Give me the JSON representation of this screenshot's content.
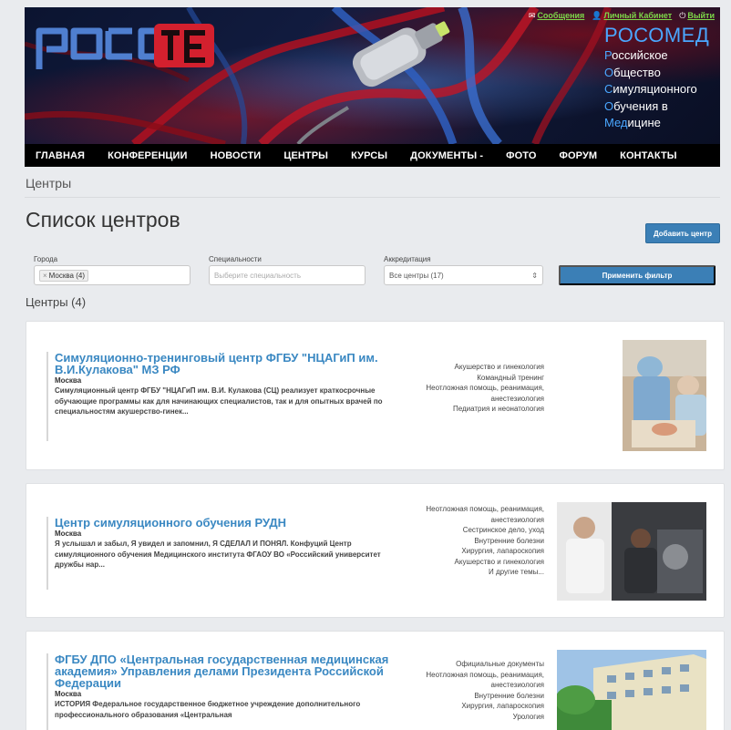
{
  "header": {
    "links": [
      {
        "icon": "envelope-icon",
        "glyph": "✉",
        "label": "Сообщения"
      },
      {
        "icon": "user-icon",
        "glyph": "👤",
        "label": "Личный Кабинет"
      },
      {
        "icon": "logout-icon",
        "glyph": "⏻",
        "label": "Выйти"
      }
    ],
    "brand_title": "РОСОМЕД",
    "brand_lines": [
      {
        "first": "Р",
        "rest": "оссийское"
      },
      {
        "first": "О",
        "rest": "бщество"
      },
      {
        "first": "С",
        "rest": "имуляционного"
      },
      {
        "first": "О",
        "rest": "бучения в"
      },
      {
        "first": "Мед",
        "rest": "ицине"
      }
    ]
  },
  "nav": [
    "ГЛАВНАЯ",
    "КОНФЕРЕНЦИИ",
    "НОВОСТИ",
    "ЦЕНТРЫ",
    "КУРСЫ",
    "ДОКУМЕНТЫ -",
    "ФОТО",
    "ФОРУМ",
    "КОНТАКТЫ"
  ],
  "breadcrumb": "Центры",
  "page_title": "Список центров",
  "add_button": "Добавить центр",
  "filters": {
    "city": {
      "label": "Города",
      "chip": "Москва (4)"
    },
    "specialty": {
      "label": "Специальности",
      "placeholder": "Выберите специальность"
    },
    "accreditation": {
      "label": "Аккредитация",
      "value": "Все центры (17)"
    },
    "apply": "Применить фильтр"
  },
  "section_title": "Центры (4)",
  "centers": [
    {
      "title": "Симуляционно-тренинговый центр ФГБУ \"НЦАГиП им. В.И.Кулакова\" МЗ РФ",
      "city": "Москва",
      "desc": "Симуляционный центр ФГБУ \"НЦАГиП им. В.И. Кулакова (СЦ) реализует краткосрочные обучающие программы как для начинающих специалистов, так и для опытных врачей по специальностям акушерство-гинек...",
      "tags": [
        "Акушерство и гинекология",
        "Командный тренинг",
        "Неотложная помощь, реанимация, анестезиология",
        "Педиатрия и неонатология"
      ]
    },
    {
      "title": "Центр симуляционного обучения РУДН",
      "city": "Москва",
      "desc": "Я услышал и забыл, Я увидел и запомнил, Я СДЕЛАЛ И ПОНЯЛ. Конфуций   Центр симуляционного обучения Медицинского института ФГАОУ ВО «Российский университет дружбы нар...",
      "tags": [
        "Неотложная помощь, реанимация, анестезиология",
        "Сестринское дело, уход",
        "Внутренние болезни",
        "Хирургия, лапароскопия",
        "Акушерство и гинекология",
        "И другие темы..."
      ]
    },
    {
      "title": "ФГБУ ДПО «Центральная государственная медицинская академия» Управления делами Президента Российской Федерации",
      "city": "Москва",
      "desc": "ИСТОРИЯ Федеральное государственное бюджетное учреждение дополнительного профессионального образования «Центральная",
      "tags": [
        "Официальные документы",
        "Неотложная помощь, реанимация, анестезиология",
        "Внутренние болезни",
        "Хирургия, лапароскопия",
        "Урология"
      ]
    }
  ]
}
